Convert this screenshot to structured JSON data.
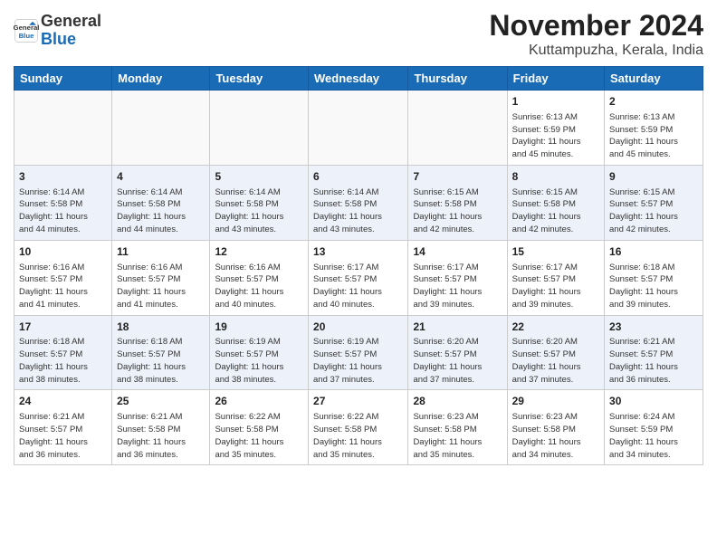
{
  "header": {
    "logo_line1": "General",
    "logo_line2": "Blue",
    "month_title": "November 2024",
    "subtitle": "Kuttampuzha, Kerala, India"
  },
  "weekdays": [
    "Sunday",
    "Monday",
    "Tuesday",
    "Wednesday",
    "Thursday",
    "Friday",
    "Saturday"
  ],
  "weeks": [
    [
      {
        "day": "",
        "info": ""
      },
      {
        "day": "",
        "info": ""
      },
      {
        "day": "",
        "info": ""
      },
      {
        "day": "",
        "info": ""
      },
      {
        "day": "",
        "info": ""
      },
      {
        "day": "1",
        "info": "Sunrise: 6:13 AM\nSunset: 5:59 PM\nDaylight: 11 hours\nand 45 minutes."
      },
      {
        "day": "2",
        "info": "Sunrise: 6:13 AM\nSunset: 5:59 PM\nDaylight: 11 hours\nand 45 minutes."
      }
    ],
    [
      {
        "day": "3",
        "info": "Sunrise: 6:14 AM\nSunset: 5:58 PM\nDaylight: 11 hours\nand 44 minutes."
      },
      {
        "day": "4",
        "info": "Sunrise: 6:14 AM\nSunset: 5:58 PM\nDaylight: 11 hours\nand 44 minutes."
      },
      {
        "day": "5",
        "info": "Sunrise: 6:14 AM\nSunset: 5:58 PM\nDaylight: 11 hours\nand 43 minutes."
      },
      {
        "day": "6",
        "info": "Sunrise: 6:14 AM\nSunset: 5:58 PM\nDaylight: 11 hours\nand 43 minutes."
      },
      {
        "day": "7",
        "info": "Sunrise: 6:15 AM\nSunset: 5:58 PM\nDaylight: 11 hours\nand 42 minutes."
      },
      {
        "day": "8",
        "info": "Sunrise: 6:15 AM\nSunset: 5:58 PM\nDaylight: 11 hours\nand 42 minutes."
      },
      {
        "day": "9",
        "info": "Sunrise: 6:15 AM\nSunset: 5:57 PM\nDaylight: 11 hours\nand 42 minutes."
      }
    ],
    [
      {
        "day": "10",
        "info": "Sunrise: 6:16 AM\nSunset: 5:57 PM\nDaylight: 11 hours\nand 41 minutes."
      },
      {
        "day": "11",
        "info": "Sunrise: 6:16 AM\nSunset: 5:57 PM\nDaylight: 11 hours\nand 41 minutes."
      },
      {
        "day": "12",
        "info": "Sunrise: 6:16 AM\nSunset: 5:57 PM\nDaylight: 11 hours\nand 40 minutes."
      },
      {
        "day": "13",
        "info": "Sunrise: 6:17 AM\nSunset: 5:57 PM\nDaylight: 11 hours\nand 40 minutes."
      },
      {
        "day": "14",
        "info": "Sunrise: 6:17 AM\nSunset: 5:57 PM\nDaylight: 11 hours\nand 39 minutes."
      },
      {
        "day": "15",
        "info": "Sunrise: 6:17 AM\nSunset: 5:57 PM\nDaylight: 11 hours\nand 39 minutes."
      },
      {
        "day": "16",
        "info": "Sunrise: 6:18 AM\nSunset: 5:57 PM\nDaylight: 11 hours\nand 39 minutes."
      }
    ],
    [
      {
        "day": "17",
        "info": "Sunrise: 6:18 AM\nSunset: 5:57 PM\nDaylight: 11 hours\nand 38 minutes."
      },
      {
        "day": "18",
        "info": "Sunrise: 6:18 AM\nSunset: 5:57 PM\nDaylight: 11 hours\nand 38 minutes."
      },
      {
        "day": "19",
        "info": "Sunrise: 6:19 AM\nSunset: 5:57 PM\nDaylight: 11 hours\nand 38 minutes."
      },
      {
        "day": "20",
        "info": "Sunrise: 6:19 AM\nSunset: 5:57 PM\nDaylight: 11 hours\nand 37 minutes."
      },
      {
        "day": "21",
        "info": "Sunrise: 6:20 AM\nSunset: 5:57 PM\nDaylight: 11 hours\nand 37 minutes."
      },
      {
        "day": "22",
        "info": "Sunrise: 6:20 AM\nSunset: 5:57 PM\nDaylight: 11 hours\nand 37 minutes."
      },
      {
        "day": "23",
        "info": "Sunrise: 6:21 AM\nSunset: 5:57 PM\nDaylight: 11 hours\nand 36 minutes."
      }
    ],
    [
      {
        "day": "24",
        "info": "Sunrise: 6:21 AM\nSunset: 5:57 PM\nDaylight: 11 hours\nand 36 minutes."
      },
      {
        "day": "25",
        "info": "Sunrise: 6:21 AM\nSunset: 5:58 PM\nDaylight: 11 hours\nand 36 minutes."
      },
      {
        "day": "26",
        "info": "Sunrise: 6:22 AM\nSunset: 5:58 PM\nDaylight: 11 hours\nand 35 minutes."
      },
      {
        "day": "27",
        "info": "Sunrise: 6:22 AM\nSunset: 5:58 PM\nDaylight: 11 hours\nand 35 minutes."
      },
      {
        "day": "28",
        "info": "Sunrise: 6:23 AM\nSunset: 5:58 PM\nDaylight: 11 hours\nand 35 minutes."
      },
      {
        "day": "29",
        "info": "Sunrise: 6:23 AM\nSunset: 5:58 PM\nDaylight: 11 hours\nand 34 minutes."
      },
      {
        "day": "30",
        "info": "Sunrise: 6:24 AM\nSunset: 5:59 PM\nDaylight: 11 hours\nand 34 minutes."
      }
    ]
  ]
}
